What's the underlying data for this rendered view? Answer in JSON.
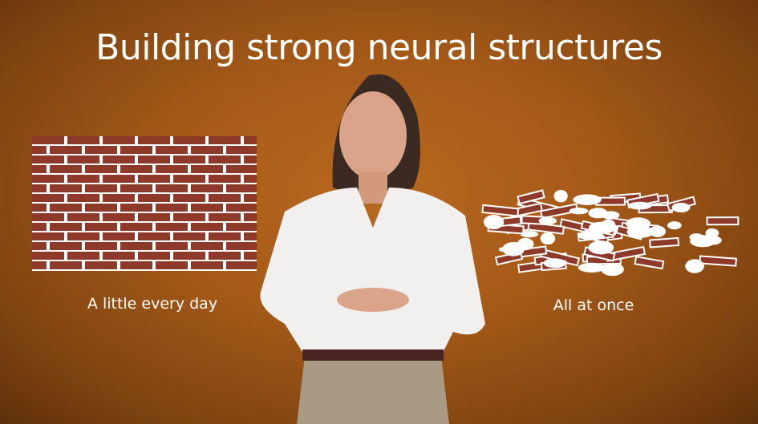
{
  "slide": {
    "title": "Building strong neural structures",
    "left_label": "A little every day",
    "right_label": "All at once"
  },
  "colors": {
    "background": "#a65a18",
    "brick": "#8e3a2a",
    "mortar": "#ffffff"
  }
}
